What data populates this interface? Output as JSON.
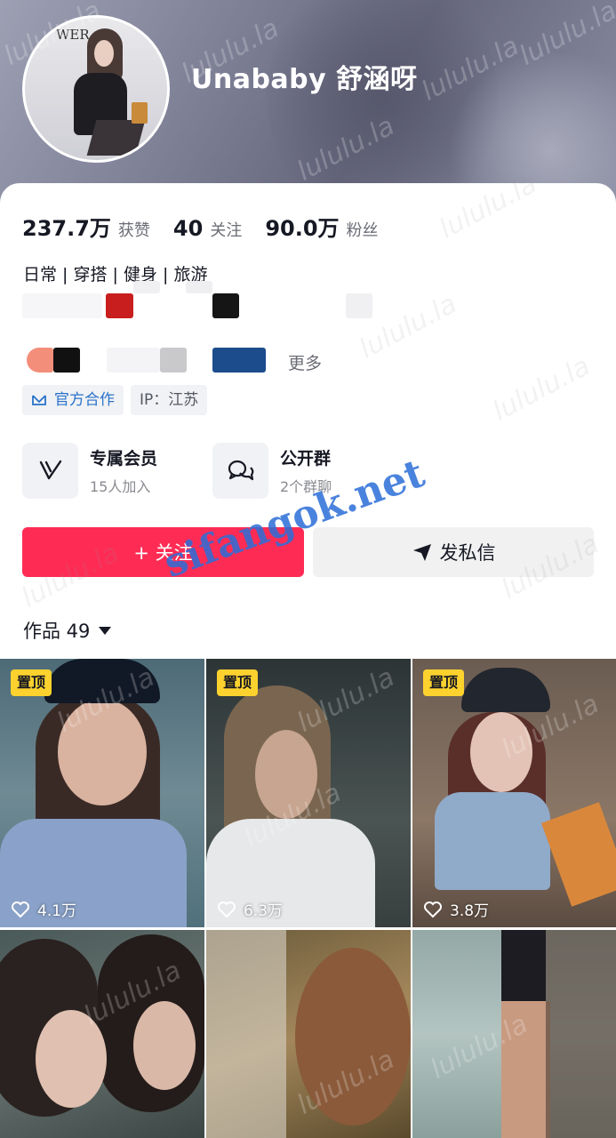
{
  "profile": {
    "username": "Unababy 舒涵呀",
    "avatar_text": "WER"
  },
  "stats": [
    {
      "value": "237.7万",
      "label": "获赞"
    },
    {
      "value": "40",
      "label": "关注"
    },
    {
      "value": "90.0万",
      "label": "粉丝"
    }
  ],
  "bio": "日常 | 穿搭 | 健身 | 旅游",
  "more_label": "更多",
  "tags": {
    "official": "官方合作",
    "ip": "IP：江苏"
  },
  "features": [
    {
      "title": "专属会员",
      "subtitle": "15人加入",
      "icon": "v-badge-icon"
    },
    {
      "title": "公开群",
      "subtitle": "2个群聊",
      "icon": "chat-bubbles-icon"
    }
  ],
  "actions": {
    "follow": "+ 关注",
    "message": "发私信"
  },
  "works": {
    "label": "作品 49"
  },
  "videos": [
    {
      "pinned": "置顶",
      "likes": "4.1万"
    },
    {
      "pinned": "置顶",
      "likes": "6.3万"
    },
    {
      "pinned": "置顶",
      "likes": "3.8万"
    },
    {
      "pinned": "",
      "likes": ""
    },
    {
      "pinned": "",
      "likes": ""
    },
    {
      "pinned": "",
      "likes": ""
    }
  ],
  "watermarks": {
    "repeat": "lululu.la",
    "site": "sifangok.net"
  },
  "colors": {
    "accent": "#fe2c55",
    "pin": "#fdd22e",
    "official_blue": "#2a73c9"
  }
}
